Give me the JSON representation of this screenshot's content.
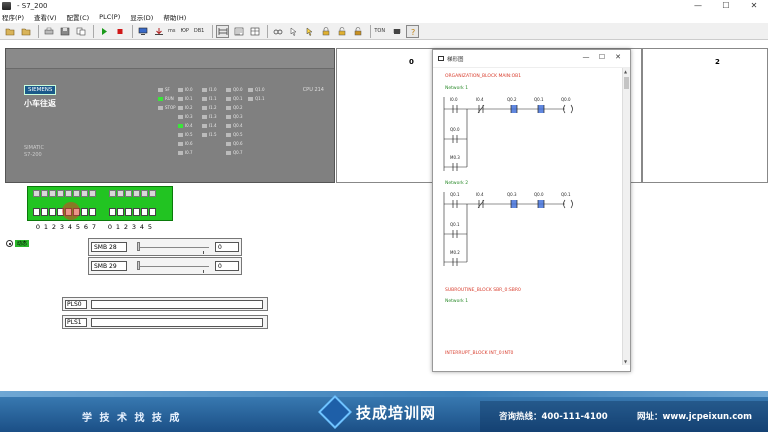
{
  "window": {
    "title": "- S7_200",
    "minimize": "—",
    "maximize": "☐",
    "close": "✕"
  },
  "menu": [
    "程序(P)",
    "查看(V)",
    "配置(C)",
    "PLC(P)",
    "显示(D)",
    "帮助(H)"
  ],
  "toolbar": {
    "text_buttons": [
      "ms",
      "ЮР",
      "DB1",
      "TON"
    ]
  },
  "plc": {
    "brand": "SIEMENS",
    "name": "小车往返",
    "simatic": "SIMATIC",
    "model": "S7-200",
    "cpu": "CPU 214",
    "status_leds": [
      {
        "label": "SF",
        "on": false
      },
      {
        "label": "RUN",
        "on": true
      },
      {
        "label": "STOP",
        "on": false
      }
    ],
    "inputs_a": [
      "I0.0",
      "I0.1",
      "I0.2",
      "I0.3",
      "I0.4",
      "I0.5",
      "I0.6",
      "I0.7"
    ],
    "inputs_b": [
      "I1.0",
      "I1.1",
      "I1.2",
      "I1.3",
      "I1.4",
      "I1.5"
    ],
    "outputs_a": [
      "Q0.0",
      "Q0.1",
      "Q0.2",
      "Q0.3",
      "Q0.4",
      "Q0.5",
      "Q0.6",
      "Q0.7"
    ],
    "outputs_b": [
      "Q1.0",
      "Q1.1"
    ],
    "input_led_states": [
      false,
      false,
      false,
      false,
      true,
      false,
      false,
      false
    ]
  },
  "panes": [
    {
      "number": "0"
    },
    {
      "number": "1"
    },
    {
      "number": "2"
    }
  ],
  "switches": {
    "numbers_a": [
      "0",
      "1",
      "2",
      "3",
      "4",
      "5",
      "6",
      "7"
    ],
    "numbers_b": [
      "0",
      "1",
      "2",
      "3",
      "4",
      "5"
    ]
  },
  "radio": {
    "label": "动态"
  },
  "sliders": [
    {
      "label": "SMB 28",
      "value": "0"
    },
    {
      "label": "SMB 29",
      "value": "0"
    }
  ],
  "pulse_outputs": [
    {
      "label": "PLS0"
    },
    {
      "label": "PLS1"
    }
  ],
  "ladder": {
    "title": "梯形图",
    "minimize": "—",
    "maximize": "☐",
    "close": "✕",
    "blocks": [
      {
        "name": "ORGANIZATION_BLOCK MAIN:OB1"
      },
      {
        "name": "SUBROUTINE_BLOCK SBR_0:SBR0"
      },
      {
        "name": "INTERRUPT_BLOCK INT_0:INT0"
      }
    ],
    "networks": [
      {
        "title": "Network 1",
        "series": [
          "I0.0",
          "I0.4",
          "Q0.2",
          "Q0.1",
          "Q0.0"
        ],
        "branches": [
          "Q0.0",
          "M0.3"
        ]
      },
      {
        "title": "Network 2",
        "series": [
          "Q0.1",
          "I0.4",
          "Q0.3",
          "Q0.0",
          "Q0.1"
        ],
        "branches": [
          "Q0.1",
          "M0.2"
        ]
      },
      {
        "title": "Network 1"
      }
    ]
  },
  "banner": {
    "slogan": "学 技 术    找 技 成",
    "logo": "技成培训网",
    "phone": "咨询热线：400-111-4100",
    "url": "网址：www.jcpeixun.com"
  }
}
